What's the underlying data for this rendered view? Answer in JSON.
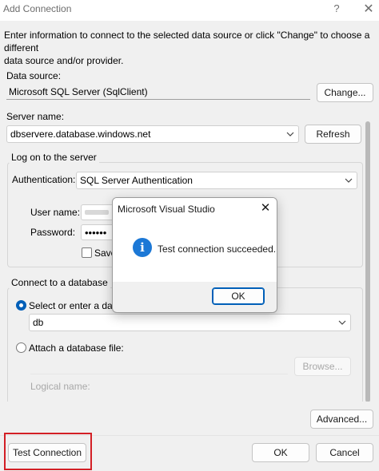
{
  "window": {
    "title": "Add Connection",
    "help_glyph": "?",
    "close_glyph": "✕"
  },
  "intro_text_line1": "Enter information to connect to the selected data source or click \"Change\" to choose a different",
  "intro_text_line2": "data source and/or provider.",
  "data_source": {
    "label": "Data source:",
    "value": "Microsoft SQL Server (SqlClient)",
    "change_button": "Change..."
  },
  "server": {
    "label": "Server name:",
    "value": "dbservere.database.windows.net",
    "refresh_button": "Refresh"
  },
  "logon": {
    "group_label": "Log on to the server",
    "auth_label": "Authentication:",
    "auth_value": "SQL Server Authentication",
    "username_label": "User name:",
    "password_label": "Password:",
    "password_mask": "••••••",
    "save_label": "Save"
  },
  "database": {
    "group_label": "Connect to a database",
    "select_option_label": "Select or enter a datab",
    "db_value": "db",
    "attach_option_label": "Attach a database file:",
    "browse_button": "Browse...",
    "logical_name_label": "Logical name:"
  },
  "advanced_button": "Advanced...",
  "footer": {
    "test_button": "Test Connection",
    "ok_button": "OK",
    "cancel_button": "Cancel"
  },
  "dialog": {
    "title": "Microsoft Visual Studio",
    "close_glyph": "✕",
    "icon_glyph": "i",
    "message": "Test connection succeeded.",
    "ok_button": "OK"
  },
  "colors": {
    "accent": "#005fb8",
    "highlight": "#d31f25",
    "info_icon": "#1c78d6"
  }
}
